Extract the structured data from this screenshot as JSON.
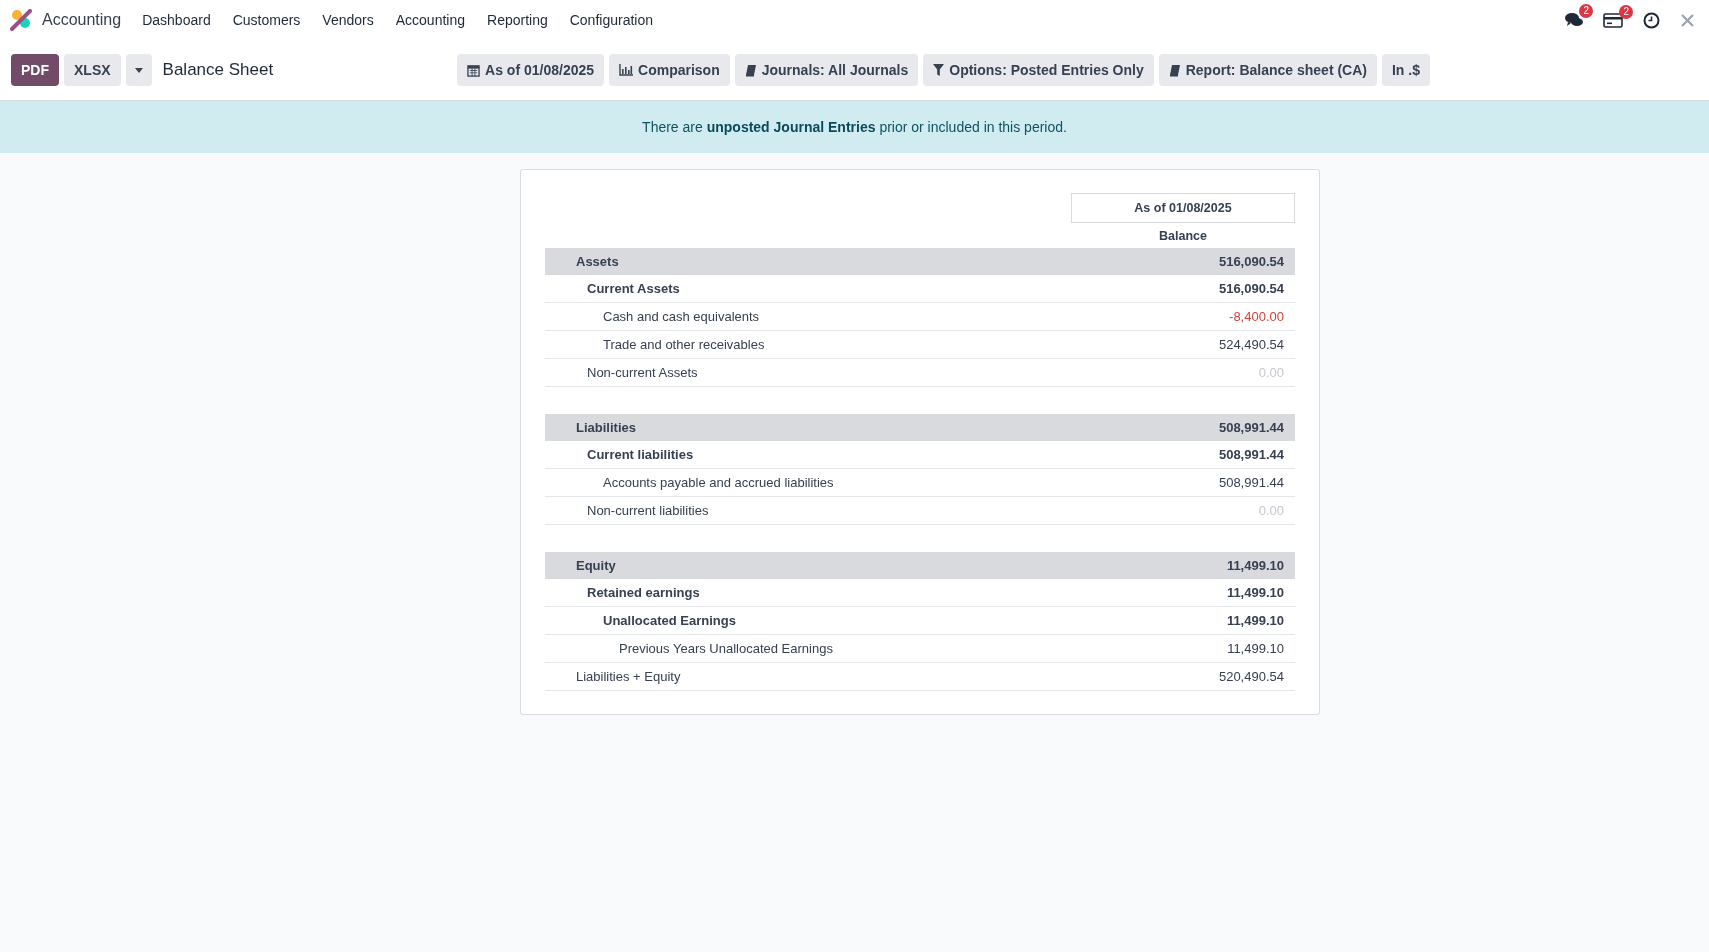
{
  "navbar": {
    "app_name": "Accounting",
    "menu": [
      "Dashboard",
      "Customers",
      "Vendors",
      "Accounting",
      "Reporting",
      "Configuration"
    ],
    "messages_badge": "2",
    "activities_badge": "2"
  },
  "control_panel": {
    "export_buttons": [
      {
        "label": "PDF",
        "selected": true
      },
      {
        "label": "XLSX",
        "selected": false
      }
    ],
    "title": "Balance Sheet",
    "filters": [
      {
        "kind": "date",
        "label": "As of 01/08/2025"
      },
      {
        "kind": "comparison",
        "label": "Comparison"
      },
      {
        "kind": "journals",
        "label": "Journals: All Journals"
      },
      {
        "kind": "options",
        "label": "Options: Posted Entries Only"
      },
      {
        "kind": "report",
        "label": "Report: Balance sheet (CA)"
      },
      {
        "kind": "currency",
        "label": "In .$"
      }
    ]
  },
  "warning": {
    "before": "There are",
    "link": "unposted Journal Entries",
    "after": "prior or included in this period."
  },
  "report": {
    "period": "As of 01/08/2025",
    "column": "Balance",
    "rows": [
      {
        "label": "Assets",
        "value": "516,090.54",
        "kind": "normal",
        "children": [
          {
            "label": "Current Assets",
            "value": "516,090.54",
            "kind": "normal",
            "children": [
              {
                "label": "Cash and cash equivalents",
                "value": "-8,400.00",
                "kind": "negative"
              },
              {
                "label": "Trade and other receivables",
                "value": "524,490.54",
                "kind": "normal"
              }
            ]
          },
          {
            "label": "Non-current Assets",
            "value": "0.00",
            "kind": "zero"
          }
        ]
      },
      {
        "label": "Liabilities",
        "value": "508,991.44",
        "kind": "normal",
        "children": [
          {
            "label": "Current liabilities",
            "value": "508,991.44",
            "kind": "normal",
            "children": [
              {
                "label": "Accounts payable and accrued liabilities",
                "value": "508,991.44",
                "kind": "normal"
              }
            ]
          },
          {
            "label": "Non-current liabilities",
            "value": "0.00",
            "kind": "zero"
          }
        ]
      },
      {
        "label": "Equity",
        "value": "11,499.10",
        "kind": "normal",
        "children": [
          {
            "label": "Retained earnings",
            "value": "11,499.10",
            "kind": "normal",
            "children": [
              {
                "label": "Unallocated Earnings",
                "value": "11,499.10",
                "kind": "normal",
                "children": [
                  {
                    "label": "Previous Years Unallocated Earnings",
                    "value": "11,499.10",
                    "kind": "normal"
                  }
                ]
              }
            ]
          }
        ]
      },
      {
        "label": "Liabilities + Equity",
        "value": "520,490.54",
        "kind": "normal"
      }
    ]
  }
}
